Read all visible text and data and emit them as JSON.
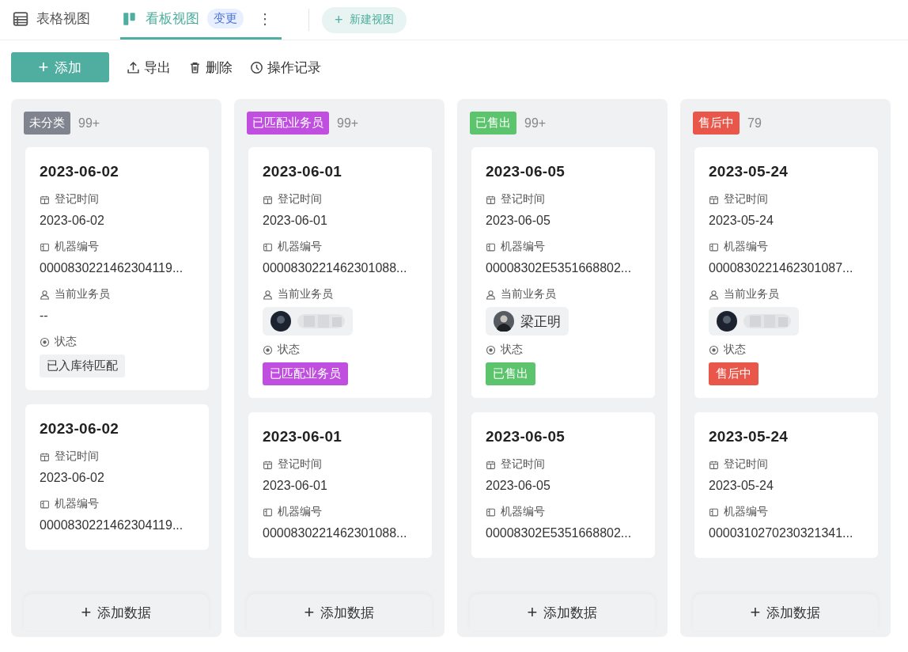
{
  "view_tabs": [
    {
      "label": "表格视图",
      "kind": "table",
      "selected": false
    },
    {
      "label": "看板视图",
      "kind": "board",
      "selected": true,
      "badge": "变更",
      "more": "⋮"
    }
  ],
  "new_view_button": {
    "icon": "+",
    "label": "新建视图"
  },
  "toolbar": {
    "add_button": {
      "icon": "+",
      "label": "添加"
    },
    "actions": [
      {
        "kind": "export",
        "label": "导出"
      },
      {
        "kind": "delete",
        "label": "删除"
      },
      {
        "kind": "history",
        "label": "操作记录"
      }
    ]
  },
  "columns": [
    {
      "tag": "未分类",
      "color": "#80848f",
      "count": "99+",
      "add_label": "添加数据",
      "cards": [
        {
          "title": "2023-06-02",
          "fields": [
            {
              "kind": "date",
              "label": "登记时间",
              "value": "2023-06-02"
            },
            {
              "kind": "machine",
              "label": "机器编号",
              "value": "0000830221462304119..."
            },
            {
              "kind": "person",
              "label": "当前业务员",
              "value": "--"
            },
            {
              "kind": "status",
              "label": "状态",
              "value": "已入库待匹配"
            }
          ]
        },
        {
          "title": "2023-06-02",
          "fields": [
            {
              "kind": "date",
              "label": "登记时间",
              "value": "2023-06-02"
            },
            {
              "kind": "machine",
              "label": "机器编号",
              "value": "0000830221462304119..."
            }
          ]
        }
      ]
    },
    {
      "tag": "已匹配业务员",
      "color": "#c04fe0",
      "count": "99+",
      "add_label": "添加数据",
      "cards": [
        {
          "title": "2023-06-01",
          "fields": [
            {
              "kind": "date",
              "label": "登记时间",
              "value": "2023-06-01"
            },
            {
              "kind": "machine",
              "label": "机器编号",
              "value": "0000830221462301088..."
            },
            {
              "kind": "person",
              "label": "当前业务员",
              "person": {
                "kind": "blurred"
              }
            },
            {
              "kind": "status",
              "label": "状态",
              "value": "已匹配业务员",
              "color": "#c04fe0"
            }
          ]
        },
        {
          "title": "2023-06-01",
          "fields": [
            {
              "kind": "date",
              "label": "登记时间",
              "value": "2023-06-01"
            },
            {
              "kind": "machine",
              "label": "机器编号",
              "value": "0000830221462301088..."
            }
          ]
        }
      ]
    },
    {
      "tag": "已售出",
      "color": "#5cc46c",
      "count": "99+",
      "add_label": "添加数据",
      "cards": [
        {
          "title": "2023-06-05",
          "fields": [
            {
              "kind": "date",
              "label": "登记时间",
              "value": "2023-06-05"
            },
            {
              "kind": "machine",
              "label": "机器编号",
              "value": "00008302E5351668802..."
            },
            {
              "kind": "person",
              "label": "当前业务员",
              "person": {
                "kind": "named",
                "name": "梁正明"
              }
            },
            {
              "kind": "status",
              "label": "状态",
              "value": "已售出",
              "color": "#5cc46c"
            }
          ]
        },
        {
          "title": "2023-06-05",
          "fields": [
            {
              "kind": "date",
              "label": "登记时间",
              "value": "2023-06-05"
            },
            {
              "kind": "machine",
              "label": "机器编号",
              "value": "00008302E5351668802..."
            }
          ]
        }
      ]
    },
    {
      "tag": "售后中",
      "color": "#e9574a",
      "count": "79",
      "add_label": "添加数据",
      "cards": [
        {
          "title": "2023-05-24",
          "fields": [
            {
              "kind": "date",
              "label": "登记时间",
              "value": "2023-05-24"
            },
            {
              "kind": "machine",
              "label": "机器编号",
              "value": "0000830221462301087..."
            },
            {
              "kind": "person",
              "label": "当前业务员",
              "person": {
                "kind": "blurred"
              }
            },
            {
              "kind": "status",
              "label": "状态",
              "value": "售后中",
              "color": "#e9574a"
            }
          ]
        },
        {
          "title": "2023-05-24",
          "fields": [
            {
              "kind": "date",
              "label": "登记时间",
              "value": "2023-05-24"
            },
            {
              "kind": "machine",
              "label": "机器编号",
              "value": "0000310270230321341..."
            }
          ]
        }
      ]
    }
  ]
}
